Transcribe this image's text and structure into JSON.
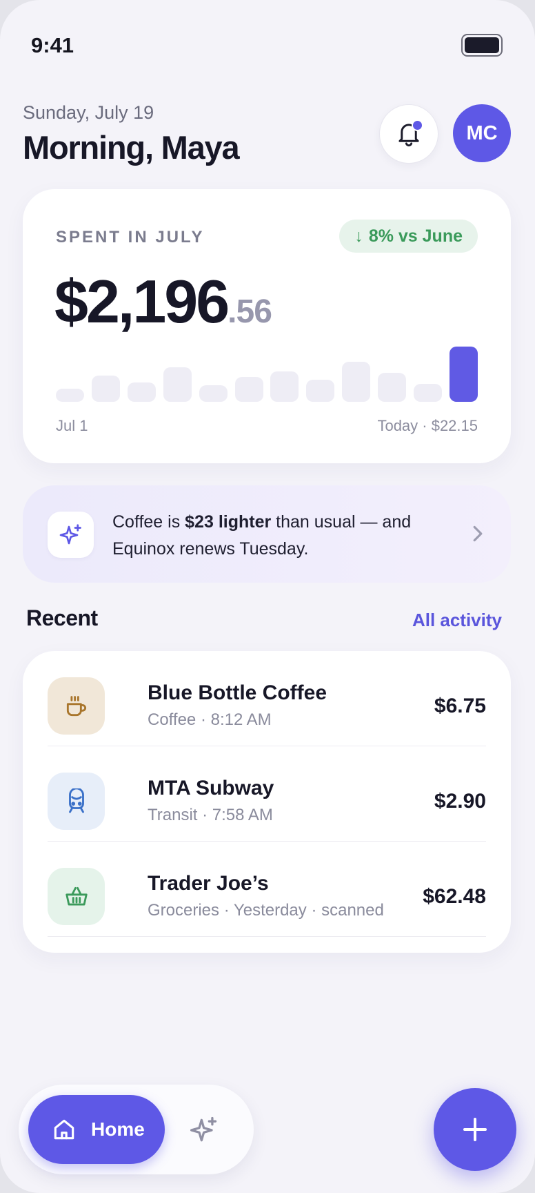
{
  "status_bar": {
    "time": "9:41",
    "battery_icon": "battery-icon"
  },
  "header": {
    "date": "Sunday, July 19",
    "greeting": "Morning, Maya",
    "bell_icon": "bell-icon",
    "has_unread": true,
    "avatar_initials": "MC"
  },
  "summary": {
    "label": "SPENT IN JULY",
    "delta_arrow": "↓",
    "delta_text": "8% vs June",
    "amount_main": "$2,196",
    "amount_cents": ".56",
    "start_label": "Jul 1",
    "end_label": "Today · $22.15",
    "daily_relative_levels": [
      0.24,
      0.48,
      0.35,
      0.62,
      0.3,
      0.45,
      0.55,
      0.4,
      0.72,
      0.52,
      0.33,
      1.0
    ]
  },
  "insight": {
    "icon": "sparkle-icon",
    "text_before": "Coffee is ",
    "text_bold": "$23 lighter",
    "text_after": " than usual — and Equinox renews Tuesday.",
    "chevron_icon": "chevron-right-icon"
  },
  "recent": {
    "title": "Recent",
    "all_link": "All activity",
    "transactions": [
      {
        "name": "Blue Bottle Coffee",
        "meta": "Coffee · 8:12 AM",
        "amount": "$6.75",
        "icon": "coffee-cup-icon",
        "icon_bg": "#f1e7d8",
        "icon_color": "#a9762c"
      },
      {
        "name": "MTA Subway",
        "meta": "Transit · 7:58 AM",
        "amount": "$2.90",
        "icon": "subway-train-icon",
        "icon_bg": "#e7eef9",
        "icon_color": "#3a70c8"
      },
      {
        "name": "Trader Joe’s",
        "meta": "Groceries · Yesterday · scanned",
        "amount": "$62.48",
        "icon": "shopping-basket-icon",
        "icon_bg": "#e5f3ea",
        "icon_color": "#3b9a5b"
      }
    ]
  },
  "nav": {
    "home_label": "Home",
    "home_icon": "home-icon",
    "assistant_icon": "sparkle-icon",
    "add_icon": "plus-icon"
  },
  "colors": {
    "accent": "#5e58e6",
    "positive": "#3a9a5a",
    "background": "#f4f3f9"
  }
}
